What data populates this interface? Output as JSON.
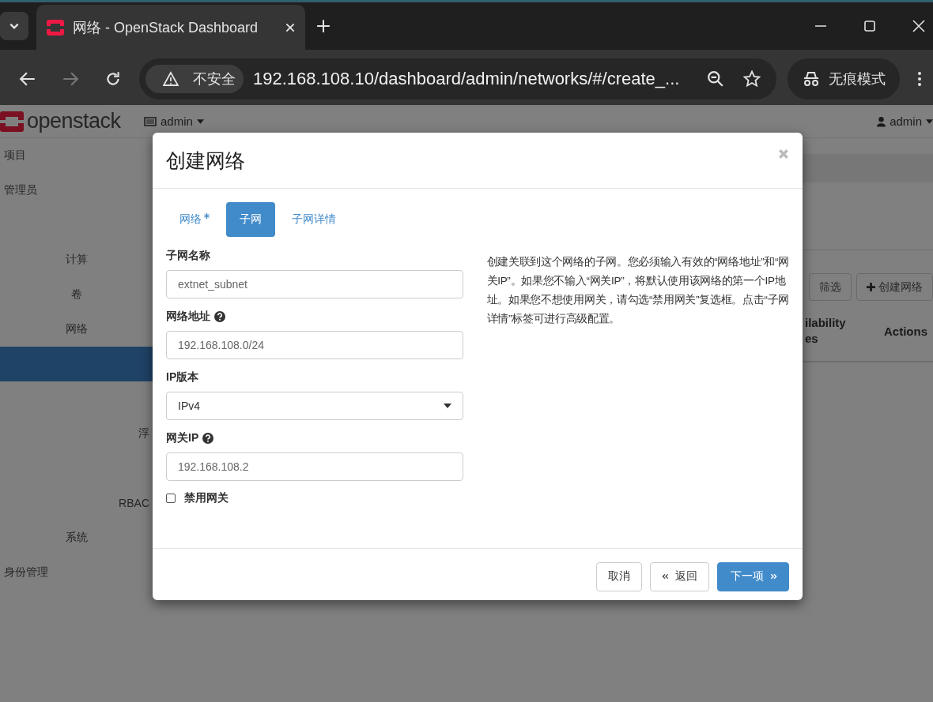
{
  "browser": {
    "tab_title": "网络 - OpenStack Dashboard",
    "security": "不安全",
    "url": "192.168.108.10/dashboard/admin/networks/#/create_...",
    "profile": "无痕模式"
  },
  "header": {
    "logo": "openstack",
    "project": "admin",
    "user": "admin"
  },
  "sidebar": {
    "items": [
      {
        "kind": "panel",
        "label": "项目"
      },
      {
        "kind": "panel",
        "label": "管理员"
      },
      {
        "kind": "link"
      },
      {
        "kind": "group",
        "label": "计算"
      },
      {
        "kind": "group",
        "label": "卷"
      },
      {
        "kind": "group",
        "label": "网络"
      },
      {
        "kind": "link",
        "selected": true
      },
      {
        "kind": "link",
        "selected": false
      },
      {
        "kind": "link",
        "selected": false,
        "label": "浮"
      },
      {
        "kind": "link",
        "selected": false
      },
      {
        "kind": "link",
        "selected": false,
        "label": "RBAC"
      },
      {
        "kind": "group",
        "label": "系统"
      },
      {
        "kind": "panel",
        "label": "身份管理"
      }
    ]
  },
  "main": {
    "buttons": [
      {
        "kind": "plain",
        "label": "筛选"
      },
      {
        "kind": "create",
        "label": "创建网络"
      }
    ],
    "columns": [
      [
        "ilability",
        "es"
      ],
      [
        "Actions"
      ]
    ]
  },
  "modal": {
    "title": "创建网络",
    "tabs": [
      {
        "label": "网络",
        "required": true,
        "selected": false
      },
      {
        "label": "子网",
        "required": false,
        "selected": true
      },
      {
        "label": "子网详情",
        "required": false,
        "selected": false
      }
    ],
    "fields": [
      {
        "kind": "text",
        "label": "子网名称",
        "help": false,
        "value": "extnet_subnet"
      },
      {
        "kind": "text",
        "label": "网络地址",
        "help": true,
        "value": "192.168.108.0/24"
      },
      {
        "kind": "select",
        "label": "IP版本",
        "help": false,
        "value": "IPv4"
      },
      {
        "kind": "text",
        "label": "网关IP",
        "help": true,
        "value": "192.168.108.2"
      },
      {
        "kind": "checkbox",
        "label": "禁用网关",
        "checked": false
      }
    ],
    "help_text": "创建关联到这个网络的子网。您必须输入有效的“网络地址”和“网关IP”。如果您不输入“网关IP”，将默认使用该网络的第一个IP地址。如果您不想使用网关，请勾选“禁用网关”复选框。点击“子网详情”标签可进行高级配置。",
    "buttons": [
      {
        "kind": "default",
        "label": "取消"
      },
      {
        "kind": "back",
        "label": "返回"
      },
      {
        "kind": "primary",
        "label": "下一项"
      }
    ]
  }
}
